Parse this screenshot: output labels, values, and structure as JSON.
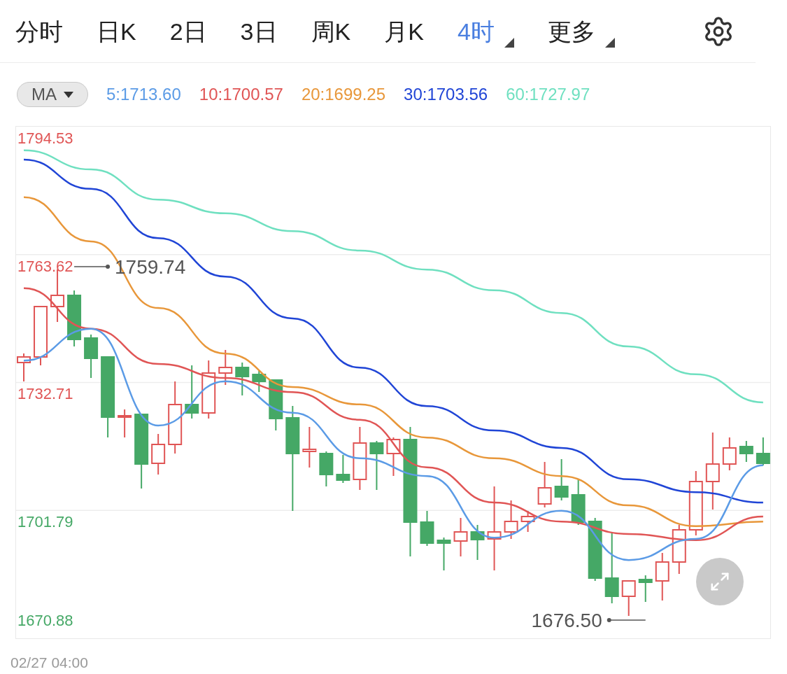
{
  "tabs": [
    {
      "label": "分时",
      "selected": false,
      "has_menu": false
    },
    {
      "label": "日K",
      "selected": false,
      "has_menu": false
    },
    {
      "label": "2日",
      "selected": false,
      "has_menu": false
    },
    {
      "label": "3日",
      "selected": false,
      "has_menu": false
    },
    {
      "label": "周K",
      "selected": false,
      "has_menu": false
    },
    {
      "label": "月K",
      "selected": false,
      "has_menu": false
    },
    {
      "label": "4时",
      "selected": true,
      "has_menu": true
    },
    {
      "label": "更多",
      "selected": false,
      "has_menu": true
    }
  ],
  "indicator_selector": {
    "label": "MA"
  },
  "legend": [
    {
      "text": "5:1713.60",
      "color": "#5b9be6"
    },
    {
      "text": "10:1700.57",
      "color": "#e05555"
    },
    {
      "text": "20:1699.25",
      "color": "#e8973a"
    },
    {
      "text": "30:1703.56",
      "color": "#2045d6"
    },
    {
      "text": "60:1727.97",
      "color": "#6fe0c0"
    }
  ],
  "chart": {
    "y_labels": [
      {
        "text": "1794.53",
        "color": "#e05555"
      },
      {
        "text": "1763.62",
        "color": "#e05555"
      },
      {
        "text": "1732.71",
        "color": "#e05555"
      },
      {
        "text": "1701.79",
        "color": "#45a866"
      },
      {
        "text": "1670.88",
        "color": "#45a866"
      }
    ],
    "chart_data": {
      "type": "line",
      "ylim": [
        1670.88,
        1794.53
      ],
      "yticks": [
        1794.53,
        1763.62,
        1732.71,
        1701.79
      ],
      "grid": true,
      "series": [
        {
          "color": "#6fe0c0",
          "values": [
            1788.8,
            1784.2,
            1776.9,
            1773.6,
            1769.3,
            1764.6,
            1760,
            1755,
            1749.5,
            1741.4,
            1734.7,
            1727.9
          ]
        },
        {
          "color": "#2045d6",
          "values": [
            1786.6,
            1779.5,
            1767.6,
            1758.3,
            1748.2,
            1736.3,
            1727,
            1721.1,
            1716.9,
            1709.3,
            1706.2,
            1703.7
          ]
        },
        {
          "color": "#e8973a",
          "values": [
            1777.5,
            1766.8,
            1750.7,
            1739.7,
            1731.6,
            1727.4,
            1719.4,
            1714.4,
            1710.1,
            1703,
            1698,
            1699.1
          ]
        },
        {
          "color": "#e05555",
          "values": [
            1755.5,
            1745.7,
            1737.2,
            1733.8,
            1730.4,
            1723.7,
            1712.2,
            1703.7,
            1699.1,
            1696.1,
            1694.6,
            1700.3
          ]
        },
        {
          "color": "#5b9be6",
          "values": [
            1738,
            1745.7,
            1722.3,
            1733,
            1725.4,
            1714.4,
            1710.1,
            1695.2,
            1701.7,
            1689.8,
            1694.9,
            1712.7
          ]
        }
      ],
      "annotations": [
        "1759.74",
        "1676.50"
      ]
    },
    "start_time": "02/27 04:00"
  }
}
